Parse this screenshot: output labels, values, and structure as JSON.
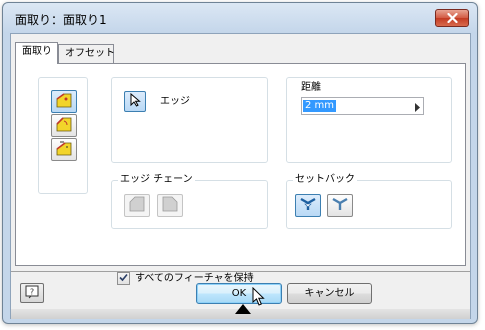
{
  "window": {
    "title": "面取り：面取り1",
    "close_icon": "close-icon"
  },
  "tabs": [
    {
      "label": "面取り",
      "active": true
    },
    {
      "label": "オフセット",
      "active": false
    }
  ],
  "method_buttons": [
    {
      "icon": "chamfer-distance-icon"
    },
    {
      "icon": "chamfer-distance-angle-icon"
    },
    {
      "icon": "chamfer-two-distances-icon"
    }
  ],
  "edge_selector": {
    "icon": "select-arrow-icon",
    "label": "エッジ"
  },
  "distance": {
    "label": "距離",
    "value": "2 mm"
  },
  "edge_chain": {
    "label": "エッジ チェーン",
    "buttons": [
      {
        "icon": "edge-chain-all-icon"
      },
      {
        "icon": "edge-chain-single-icon"
      }
    ]
  },
  "setback": {
    "label": "セットバック",
    "buttons": [
      {
        "icon": "setback-corner-icon"
      },
      {
        "icon": "setback-smooth-icon"
      }
    ]
  },
  "preserve_features": {
    "label": "すべてのフィーチャを保持",
    "checked": true
  },
  "footer": {
    "help_icon": "help-icon",
    "ok_label": "OK",
    "cancel_label": "キャンセル"
  }
}
